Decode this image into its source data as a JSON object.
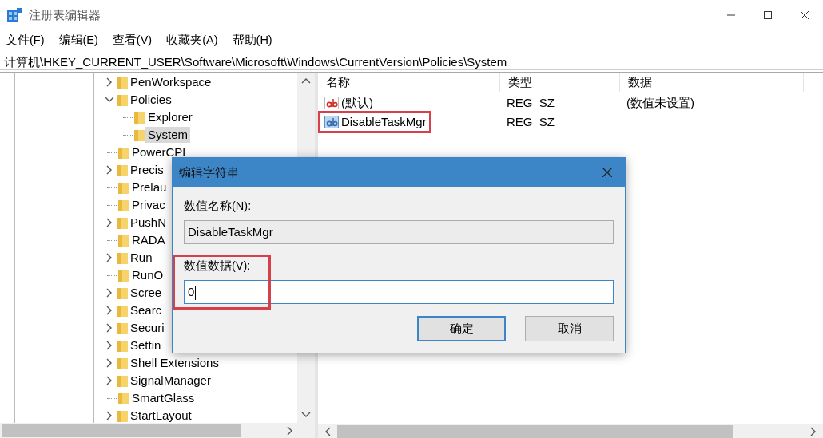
{
  "window": {
    "title": "注册表编辑器"
  },
  "menu": [
    "文件(F)",
    "编辑(E)",
    "查看(V)",
    "收藏夹(A)",
    "帮助(H)"
  ],
  "address": "计算机\\HKEY_CURRENT_USER\\Software\\Microsoft\\Windows\\CurrentVersion\\Policies\\System",
  "tree": [
    {
      "kind": "branch",
      "label": "PenWorkspace",
      "expanded": false,
      "selected": false
    },
    {
      "kind": "branch",
      "label": "Policies",
      "expanded": true,
      "selected": false,
      "children": [
        {
          "kind": "leaf",
          "label": "Explorer",
          "selected": false
        },
        {
          "kind": "leaf",
          "label": "System",
          "selected": true
        }
      ]
    },
    {
      "kind": "leaf",
      "label": "PowerCPL",
      "selected": false
    },
    {
      "kind": "branch",
      "label": "Precis",
      "expanded": false,
      "selected": false
    },
    {
      "kind": "leaf",
      "label": "Prelau",
      "selected": false
    },
    {
      "kind": "leaf",
      "label": "Privac",
      "selected": false
    },
    {
      "kind": "branch",
      "label": "PushN",
      "expanded": false,
      "selected": false
    },
    {
      "kind": "leaf",
      "label": "RADA",
      "selected": false
    },
    {
      "kind": "branch",
      "label": "Run",
      "expanded": false,
      "selected": false
    },
    {
      "kind": "leaf",
      "label": "RunO",
      "selected": false
    },
    {
      "kind": "branch",
      "label": "Scree",
      "expanded": false,
      "selected": false
    },
    {
      "kind": "branch",
      "label": "Searc",
      "expanded": false,
      "selected": false
    },
    {
      "kind": "branch",
      "label": "Securi",
      "expanded": false,
      "selected": false
    },
    {
      "kind": "branch",
      "label": "Settin",
      "expanded": false,
      "selected": false
    },
    {
      "kind": "branch",
      "label": "Shell Extensions",
      "expanded": false,
      "selected": false
    },
    {
      "kind": "branch",
      "label": "SignalManager",
      "expanded": false,
      "selected": false
    },
    {
      "kind": "leaf",
      "label": "SmartGlass",
      "selected": false
    },
    {
      "kind": "branch",
      "label": "StartLayout",
      "expanded": false,
      "selected": false
    }
  ],
  "values": {
    "columns": [
      "名称",
      "类型",
      "数据"
    ],
    "rows": [
      {
        "name": "(默认)",
        "type": "REG_SZ",
        "data": "(数值未设置)",
        "selected": false,
        "highlighted": false
      },
      {
        "name": "DisableTaskMgr",
        "type": "REG_SZ",
        "selected": true,
        "highlighted": true
      }
    ]
  },
  "dialog": {
    "title": "编辑字符串",
    "name_label": "数值名称(N):",
    "name_value": "DisableTaskMgr",
    "data_label": "数值数据(V):",
    "data_value": "0",
    "data_highlighted": true,
    "buttons": [
      {
        "label": "确定",
        "default": true
      },
      {
        "label": "取消",
        "default": false
      }
    ]
  }
}
